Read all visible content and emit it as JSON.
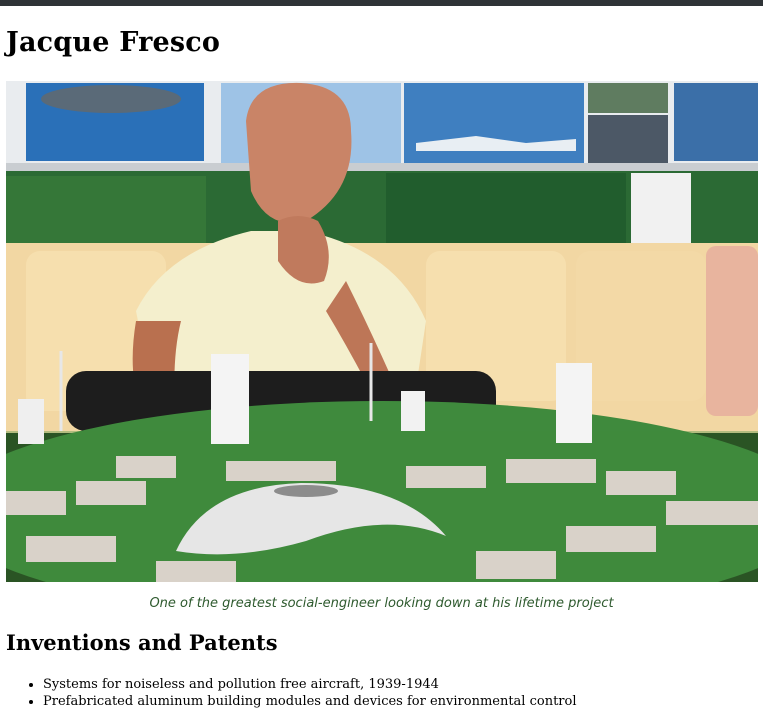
{
  "page": {
    "title": "Jacque Fresco"
  },
  "hero": {
    "alt": "Jacque Fresco looking down at a circular city model",
    "caption": "One of the greatest social-engineer looking down at his lifetime project"
  },
  "inventions": {
    "heading": "Inventions and Patents",
    "items": [
      "Systems for noiseless and pollution free aircraft, 1939-1944",
      "Prefabricated aluminum building modules and devices for environmental control"
    ]
  }
}
